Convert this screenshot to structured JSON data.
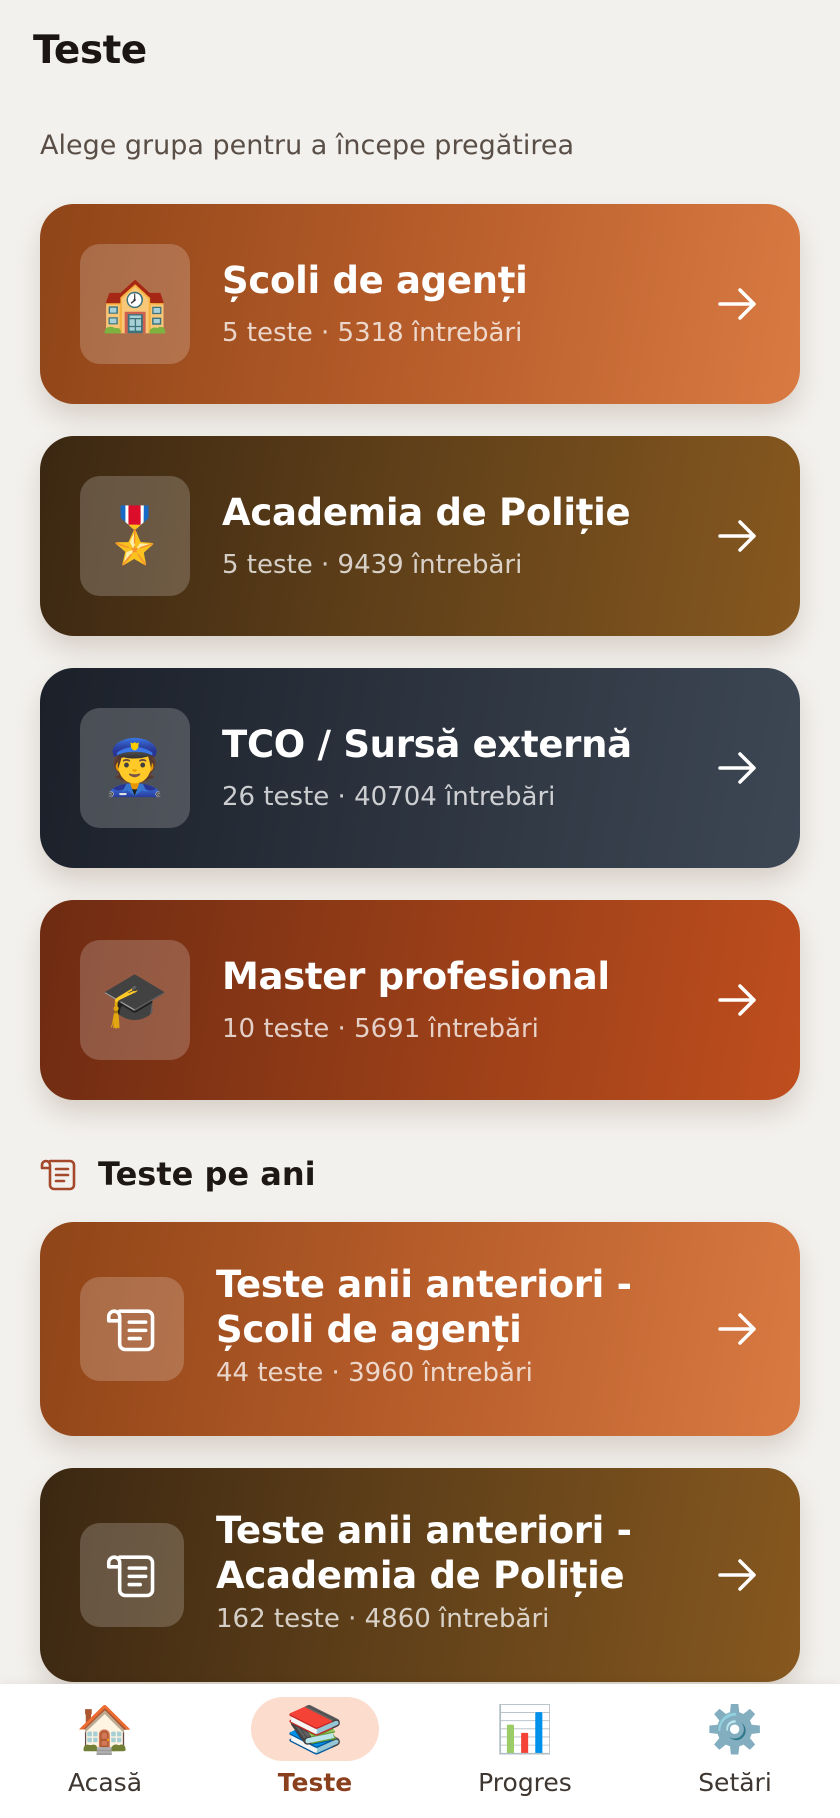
{
  "header": {
    "title": "Teste",
    "subtitle": "Alege grupa pentru a începe pregătirea"
  },
  "groups": [
    {
      "icon": "school-icon",
      "emoji": "🏫",
      "title": "Școli de agenți",
      "meta": "5 teste · 5318 întrebări"
    },
    {
      "icon": "medal-icon",
      "emoji": "🎖️",
      "title": "Academia de Poliție",
      "meta": "5 teste · 9439 întrebări"
    },
    {
      "icon": "police-officer-icon",
      "emoji": "👮",
      "title": "TCO / Sursă externă",
      "meta": "26 teste · 40704 întrebări"
    },
    {
      "icon": "graduation-cap-icon",
      "emoji": "🎓",
      "title": "Master profesional",
      "meta": "10 teste · 5691 întrebări"
    }
  ],
  "years_section": {
    "icon": "scroll-icon",
    "label": "Teste pe ani",
    "items": [
      {
        "icon": "scroll-icon",
        "title": "Teste anii anteriori - Școli de agenți",
        "meta": "44 teste · 3960 întrebări"
      },
      {
        "icon": "scroll-icon",
        "title": "Teste anii anteriori - Academia de Poliție",
        "meta": "162 teste · 4860 întrebări"
      }
    ]
  },
  "nav": {
    "items": [
      {
        "icon": "house-icon",
        "emoji": "🏠",
        "label": "Acasă",
        "active": false
      },
      {
        "icon": "books-icon",
        "emoji": "📚",
        "label": "Teste",
        "active": true
      },
      {
        "icon": "bar-chart-icon",
        "emoji": "📊",
        "label": "Progres",
        "active": false
      },
      {
        "icon": "gear-icon",
        "emoji": "⚙️",
        "label": "Setări",
        "active": false
      }
    ]
  },
  "colors": {
    "background": "#f3f1ee",
    "copper_gradient": [
      "#8f4518",
      "#d97a42"
    ],
    "bronze_gradient": [
      "#3b2712",
      "#87581f"
    ],
    "slate_gradient": [
      "#1b2029",
      "#3d4754"
    ],
    "rust_gradient": [
      "#6e2b12",
      "#bf4e1e"
    ],
    "active_nav_pill": "#fbdccd",
    "active_nav_label": "#8a3f1d"
  }
}
